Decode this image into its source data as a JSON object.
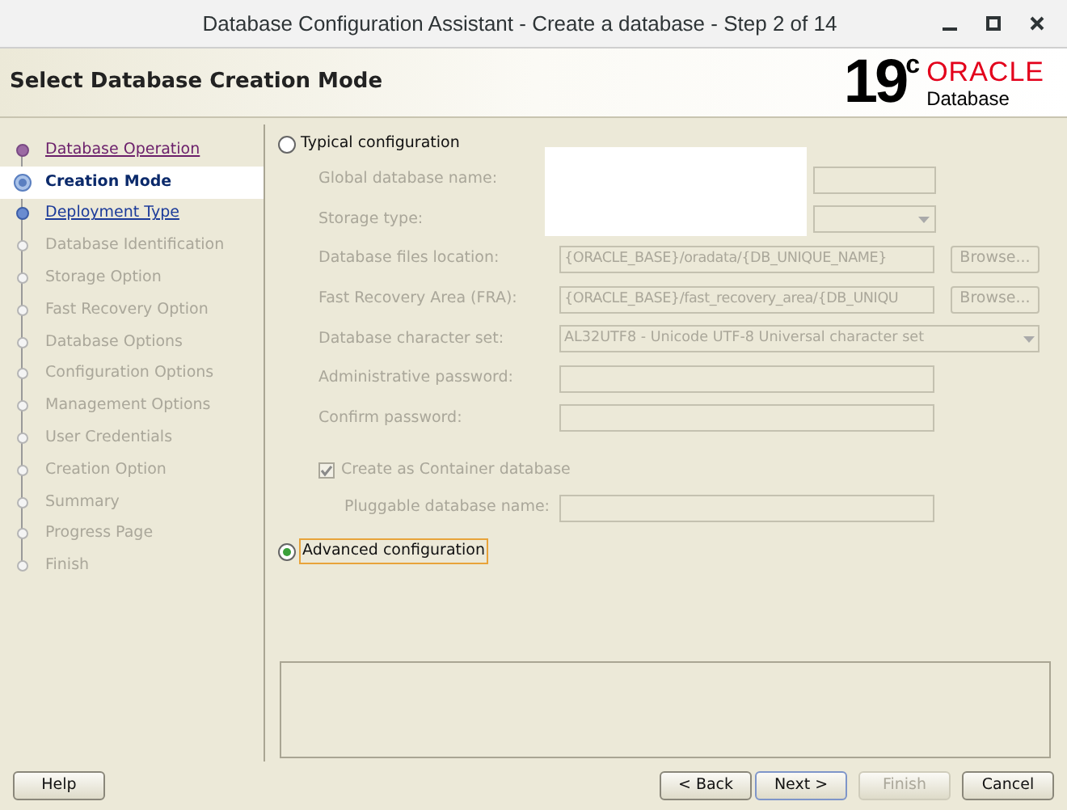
{
  "window": {
    "title": "Database Configuration Assistant - Create a database - Step 2 of 14"
  },
  "header": {
    "title": "Select Database Creation Mode",
    "logo_version": "19",
    "logo_sup": "c",
    "logo_brand": "ORACLE",
    "logo_product": "Database"
  },
  "steps": [
    {
      "label": "Database Operation",
      "kind": "visited",
      "selected": false
    },
    {
      "label": "Creation Mode",
      "kind": "current",
      "selected": true
    },
    {
      "label": "Deployment Type",
      "kind": "link",
      "selected": false
    },
    {
      "label": "Database Identification",
      "kind": "disabled",
      "selected": false
    },
    {
      "label": "Storage Option",
      "kind": "disabled",
      "selected": false
    },
    {
      "label": "Fast Recovery Option",
      "kind": "disabled",
      "selected": false
    },
    {
      "label": "Database Options",
      "kind": "disabled",
      "selected": false
    },
    {
      "label": "Configuration Options",
      "kind": "disabled",
      "selected": false
    },
    {
      "label": "Management Options",
      "kind": "disabled",
      "selected": false
    },
    {
      "label": "User Credentials",
      "kind": "disabled",
      "selected": false
    },
    {
      "label": "Creation Option",
      "kind": "disabled",
      "selected": false
    },
    {
      "label": "Summary",
      "kind": "disabled",
      "selected": false
    },
    {
      "label": "Progress Page",
      "kind": "disabled",
      "selected": false
    },
    {
      "label": "Finish",
      "kind": "disabled",
      "selected": false
    }
  ],
  "typical": {
    "label": "Typical configuration",
    "selected": false,
    "fields": [
      {
        "kind": "text",
        "label": "Global database name:"
      },
      {
        "kind": "select",
        "label": "Storage type:"
      },
      {
        "kind": "browse",
        "label": "Database files location:",
        "value": "{ORACLE_BASE}/oradata/{DB_UNIQUE_NAME}",
        "button": "Browse..."
      },
      {
        "kind": "browse",
        "label": "Fast Recovery Area (FRA):",
        "value": "{ORACLE_BASE}/fast_recovery_area/{DB_UNIQU",
        "button": "Browse..."
      },
      {
        "kind": "wideselect",
        "label": "Database character set:",
        "value": "AL32UTF8 - Unicode UTF-8 Universal character set"
      },
      {
        "kind": "text",
        "label": "Administrative password:"
      },
      {
        "kind": "text",
        "label": "Confirm password:"
      }
    ],
    "container": {
      "label": "Create as Container database",
      "checked": true
    },
    "pluggable": {
      "label": "Pluggable database name:"
    }
  },
  "advanced": {
    "label": "Advanced configuration",
    "selected": true
  },
  "buttons": [
    {
      "label": "Help",
      "disabled": false,
      "default": false
    },
    {
      "label": "< Back",
      "disabled": false,
      "default": false
    },
    {
      "label": "Next >",
      "disabled": false,
      "default": true
    },
    {
      "label": "Finish",
      "disabled": true,
      "default": false
    },
    {
      "label": "Cancel",
      "disabled": false,
      "default": false
    }
  ]
}
